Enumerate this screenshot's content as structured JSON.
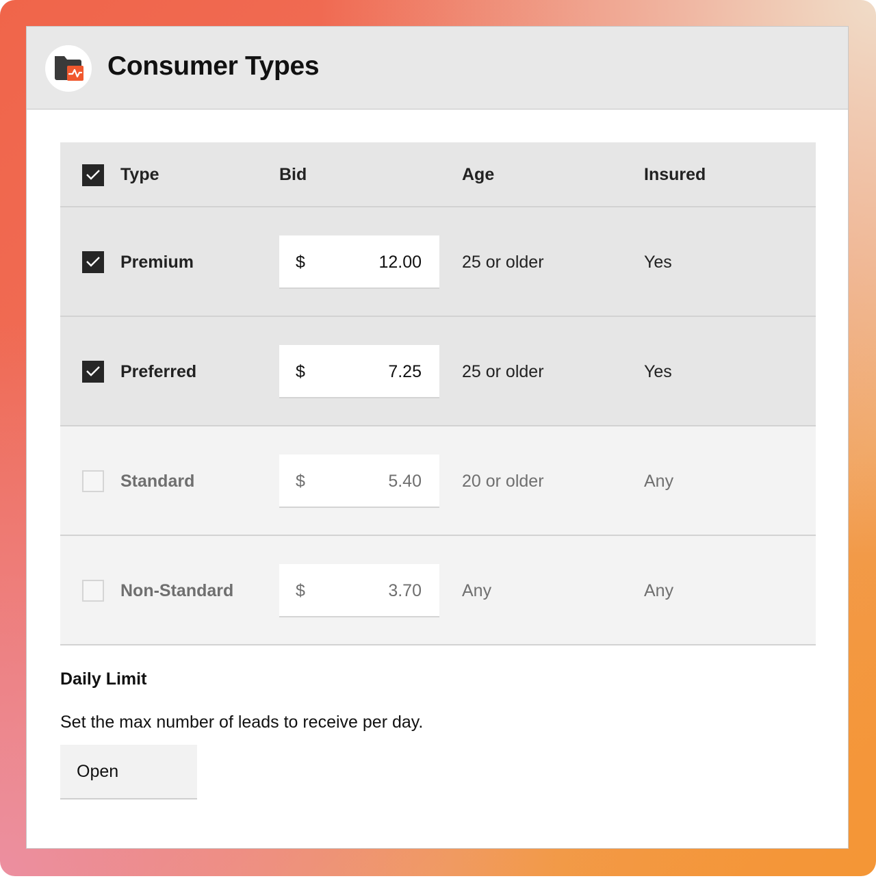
{
  "header": {
    "title": "Consumer Types",
    "logo_icon": "folder-activity-icon"
  },
  "table": {
    "select_all_checked": true,
    "columns": [
      "Type",
      "Bid",
      "Age",
      "Insured"
    ],
    "rows": [
      {
        "type": "Premium",
        "checked": true,
        "currency": "$",
        "bid": "12.00",
        "age": "25 or older",
        "insured": "Yes"
      },
      {
        "type": "Preferred",
        "checked": true,
        "currency": "$",
        "bid": "7.25",
        "age": "25 or older",
        "insured": "Yes"
      },
      {
        "type": "Standard",
        "checked": false,
        "currency": "$",
        "bid": "5.40",
        "age": "20 or older",
        "insured": "Any"
      },
      {
        "type": "Non-Standard",
        "checked": false,
        "currency": "$",
        "bid": "3.70",
        "age": "Any",
        "insured": "Any"
      }
    ]
  },
  "daily_limit": {
    "title": "Daily Limit",
    "description": "Set the max number of leads to receive per day.",
    "button_label": "Open"
  },
  "colors": {
    "accent": "#f0582e",
    "checkbox_checked": "#262626",
    "header_bg": "#e8e8e8"
  }
}
